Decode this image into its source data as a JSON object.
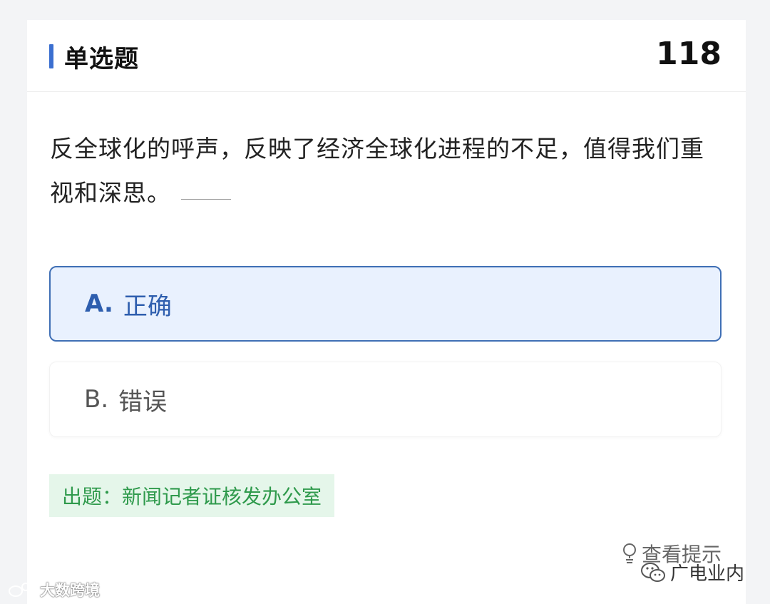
{
  "header": {
    "title": "单选题",
    "number": "118"
  },
  "question": {
    "text": "反全球化的呼声，反映了经济全球化进程的不足，值得我们重视和深思。"
  },
  "options": [
    {
      "letter": "A.",
      "label": "正确",
      "selected": true
    },
    {
      "letter": "B.",
      "label": "错误",
      "selected": false
    }
  ],
  "source": {
    "text": "出题：新闻记者证核发办公室"
  },
  "hint": {
    "label": "查看提示",
    "icon": "lightbulb-icon"
  },
  "watermarks": {
    "left": "大数跨境",
    "right": "广电业内"
  },
  "colors": {
    "accent": "#3b6fd0",
    "selected_bg": "#e9f1fe",
    "selected_border": "#3f6fb5",
    "source_bg": "#e5f6ea",
    "source_text": "#2f9a4c"
  }
}
